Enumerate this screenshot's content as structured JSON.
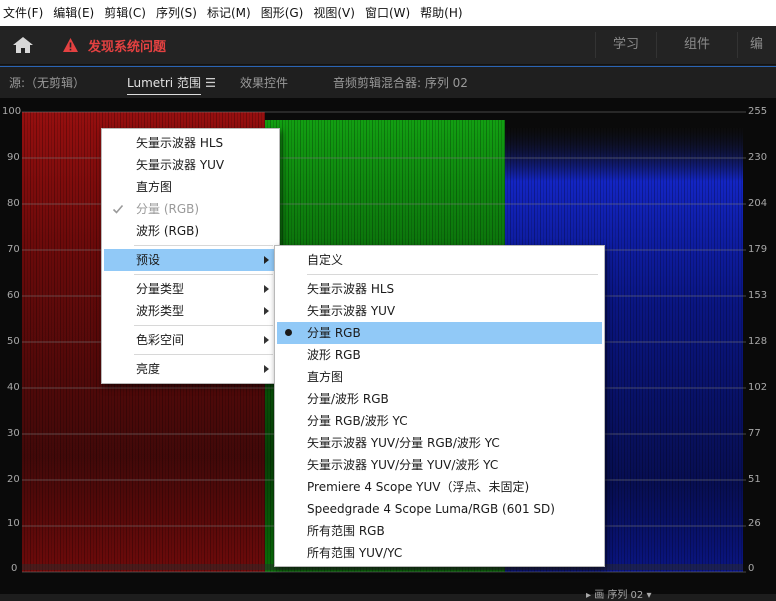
{
  "menubar": {
    "items": [
      "文件(F)",
      "编辑(E)",
      "剪辑(C)",
      "序列(S)",
      "标记(M)",
      "图形(G)",
      "视图(V)",
      "窗口(W)",
      "帮助(H)"
    ]
  },
  "header": {
    "issue_text": "发现系统问题",
    "workspaces": [
      "学习",
      "组件",
      "编"
    ],
    "issue_color": "#e44141"
  },
  "panel_tabs": {
    "source": "源:（无剪辑）",
    "lumetri": "Lumetri 范围",
    "effects": "效果控件",
    "mixer": "音频剪辑混合器: 序列 02"
  },
  "scope": {
    "left_ticks": [
      "100",
      "90",
      "80",
      "70",
      "60",
      "50",
      "40",
      "30",
      "20",
      "10",
      "0"
    ],
    "right_ticks": [
      "255",
      "230",
      "204",
      "179",
      "153",
      "128",
      "102",
      "77",
      "51",
      "26",
      "0"
    ],
    "channel_colors": [
      "#d01010",
      "#10c010",
      "#1030e0"
    ]
  },
  "context_menu": {
    "items": [
      {
        "label": "矢量示波器 HLS"
      },
      {
        "label": "矢量示波器 YUV"
      },
      {
        "label": "直方图"
      },
      {
        "label": "分量 (RGB)"
      },
      {
        "label": "波形 (RGB)"
      },
      {
        "label": "预设"
      },
      {
        "label": "分量类型"
      },
      {
        "label": "波形类型"
      },
      {
        "label": "色彩空间"
      },
      {
        "label": "亮度"
      }
    ]
  },
  "submenu": {
    "items": [
      {
        "label": "自定义"
      },
      {
        "label": "矢量示波器 HLS"
      },
      {
        "label": "矢量示波器 YUV"
      },
      {
        "label": "分量 RGB"
      },
      {
        "label": "波形 RGB"
      },
      {
        "label": "直方图"
      },
      {
        "label": "分量/波形 RGB"
      },
      {
        "label": "分量 RGB/波形 YC"
      },
      {
        "label": "矢量示波器 YUV/分量 RGB/波形 YC"
      },
      {
        "label": "矢量示波器 YUV/分量 YUV/波形 YC"
      },
      {
        "label": "Premiere 4 Scope YUV（浮点、未固定)"
      },
      {
        "label": "Speedgrade 4 Scope Luma/RGB (601 SD)"
      },
      {
        "label": "所有范围 RGB"
      },
      {
        "label": "所有范围 YUV/YC"
      }
    ]
  },
  "footer": {
    "text": "▸ 画 序列 02 ▾"
  }
}
